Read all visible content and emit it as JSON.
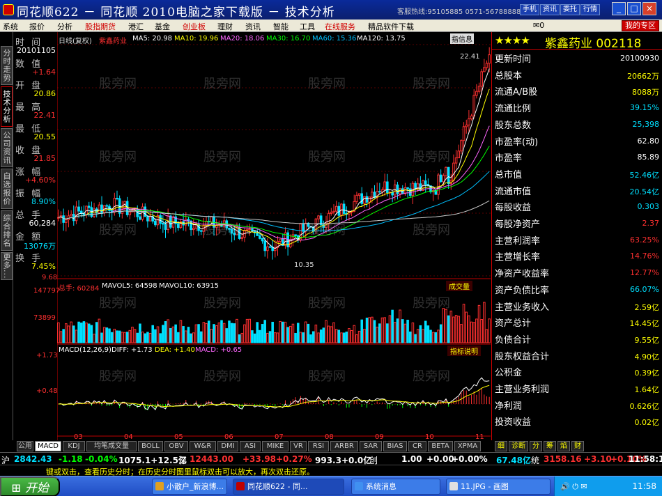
{
  "window": {
    "title": "同花顺622 － 同花顺 2010电脑之家下载版 － 技术分析",
    "hotline": "客服热线:95105885 0571-56788888",
    "buttons": [
      "手机",
      "资讯",
      "委托",
      "行情"
    ]
  },
  "menu": {
    "items": [
      {
        "label": "系统",
        "red": false
      },
      {
        "label": "报价",
        "red": false
      },
      {
        "label": "分析",
        "red": false
      },
      {
        "label": "股指期货",
        "red": true
      },
      {
        "label": "港汇",
        "red": false
      },
      {
        "label": "基金",
        "red": false
      },
      {
        "label": "创业板",
        "red": true
      },
      {
        "label": "理财",
        "red": false
      },
      {
        "label": "资讯",
        "red": false
      },
      {
        "label": "智能",
        "red": false
      },
      {
        "label": "工具",
        "red": false
      },
      {
        "label": "在线服务",
        "red": true
      },
      {
        "label": "精品软件下载",
        "red": false
      }
    ],
    "mail_count": "0",
    "zone_label": "我的专区"
  },
  "left_tabs": [
    {
      "label": "分时走势",
      "selected": false
    },
    {
      "label": "技术分析",
      "selected": true
    },
    {
      "label": "公司资讯",
      "selected": false
    },
    {
      "label": "自选报价",
      "selected": false
    },
    {
      "label": "综合排名",
      "selected": false
    },
    {
      "label": "更多...",
      "selected": false
    }
  ],
  "quote": [
    {
      "label": "时 间",
      "value": "20101105",
      "color": "#ffffff"
    },
    {
      "label": "数 值",
      "value": "+1.64",
      "color": "#ff3030"
    },
    {
      "label": "开 盘",
      "value": "20.86",
      "color": "#ffff00"
    },
    {
      "label": "最 高",
      "value": "22.41",
      "color": "#ff3030"
    },
    {
      "label": "最 低",
      "value": "20.55",
      "color": "#ffff00"
    },
    {
      "label": "收 盘",
      "value": "21.85",
      "color": "#ff3030"
    },
    {
      "label": "涨 幅",
      "value": "+4.60%",
      "color": "#ff3030"
    },
    {
      "label": "振 幅",
      "value": "8.90%",
      "color": "#00e0ff"
    },
    {
      "label": "总 手",
      "value": "60,284",
      "color": "#ffffff"
    },
    {
      "label": "金 额",
      "value": "13076万",
      "color": "#00e0ff"
    },
    {
      "label": "换 手",
      "value": "7.45%",
      "color": "#ffff00"
    }
  ],
  "chart": {
    "header": {
      "period": "日线(复权)",
      "name": "紫鑫药业",
      "ma5": "MA5: 20.98",
      "ma10": "MA10: 19.96",
      "ma20": "MA20: 18.06",
      "ma30": "MA30: 16.70",
      "ma60": "MA60: 15.36",
      "ma120": "MA120: 13.75"
    },
    "buttons": [
      "指",
      "信",
      "息"
    ],
    "high_label": "22.41",
    "low_label": "10.35",
    "ymin_label": "9.68",
    "volume": {
      "total": "总手: 60284",
      "mavol5": "MAVOL5: 64598",
      "mavol10": "MAVOL10: 63915",
      "tab": "成交量",
      "axis_top": "147797",
      "axis_mid": "73899"
    },
    "macd": {
      "header": "MACD(12,26,9)",
      "diff": "DIFF: +1.73",
      "dea": "DEA: +1.40",
      "macd": "MACD: +0.65",
      "tab": "指标说明",
      "axis_top": "+1.73",
      "axis_mid": "+0.48"
    },
    "watermark": "股旁网",
    "x_labels": [
      "03",
      "04",
      "05",
      "06",
      "07",
      "08",
      "09",
      "10",
      "11"
    ]
  },
  "chart_data": {
    "type": "candlestick",
    "symbol": "紫鑫药业",
    "x": [
      "2010-03",
      "2010-04",
      "2010-05",
      "2010-06",
      "2010-07",
      "2010-08",
      "2010-09",
      "2010-10",
      "2010-11"
    ],
    "close": [
      12.9,
      13.6,
      12.6,
      12.5,
      11.3,
      12.9,
      14.6,
      14.5,
      21.85
    ],
    "high": 22.41,
    "low": 10.35,
    "ylim": [
      9.68,
      22.41
    ],
    "ma": {
      "MA5": 20.98,
      "MA10": 19.96,
      "MA20": 18.06,
      "MA30": 16.7,
      "MA60": 15.36,
      "MA120": 13.75
    },
    "volume": {
      "total": 60284,
      "MAVOL5": 64598,
      "MAVOL10": 63915,
      "ylim": [
        0,
        147797
      ]
    },
    "macd": {
      "DIFF": 1.73,
      "DEA": 1.4,
      "MACD": 0.65
    }
  },
  "stock": {
    "stars": "★★★★",
    "name": "紫鑫药业 002118",
    "fields": [
      {
        "label": "更新时间",
        "value": "20100930",
        "color": "#ffffff"
      },
      {
        "label": "总股本",
        "value": "20662万",
        "color": "#ffff00"
      },
      {
        "label": "流通A/B股",
        "value": "8088万",
        "color": "#ffff00"
      },
      {
        "label": "流通比例",
        "value": "39.15%",
        "color": "#00e0ff"
      },
      {
        "label": "股东总数",
        "value": "25,398",
        "color": "#00e0ff"
      },
      {
        "label": "市盈率(动)",
        "value": "62.80",
        "color": "#ffffff"
      },
      {
        "label": "市盈率",
        "value": "85.89",
        "color": "#ffffff"
      },
      {
        "label": "总市值",
        "value": "52.46亿",
        "color": "#00e0ff"
      },
      {
        "label": "流通市值",
        "value": "20.54亿",
        "color": "#00e0ff"
      },
      {
        "label": "每股收益",
        "value": "0.303",
        "color": "#00e0ff"
      },
      {
        "label": "每股净资产",
        "value": "2.37",
        "color": "#ff3030"
      },
      {
        "label": "主营利润率",
        "value": "63.25%",
        "color": "#ff3030"
      },
      {
        "label": "主营增长率",
        "value": "14.76%",
        "color": "#ff3030"
      },
      {
        "label": "净资产收益率",
        "value": "12.77%",
        "color": "#ff3030"
      },
      {
        "label": "资产负债比率",
        "value": "66.07%",
        "color": "#00e0ff"
      },
      {
        "label": "主营业务收入",
        "value": "2.59亿",
        "color": "#ffff00"
      },
      {
        "label": "资产总计",
        "value": "14.45亿",
        "color": "#ffff00"
      },
      {
        "label": "负债合计",
        "value": "9.55亿",
        "color": "#ffff00"
      },
      {
        "label": "股东权益合计",
        "value": "4.90亿",
        "color": "#ffff00"
      },
      {
        "label": "公积金",
        "value": "0.39亿",
        "color": "#ffff00"
      },
      {
        "label": "主营业务利润",
        "value": "1.64亿",
        "color": "#ffff00"
      },
      {
        "label": "净利润",
        "value": "0.626亿",
        "color": "#ffff00"
      },
      {
        "label": "投资收益",
        "value": "0.02亿",
        "color": "#ffff00"
      }
    ]
  },
  "indicator_tabs": [
    {
      "label": "公用",
      "selected": false
    },
    {
      "label": "MACD",
      "selected": true
    },
    {
      "label": "KDJ",
      "selected": false
    },
    {
      "label": "均笔成交量",
      "selected": false
    },
    {
      "label": "BOLL",
      "selected": false
    },
    {
      "label": "OBV",
      "selected": false
    },
    {
      "label": "W&R",
      "selected": false
    },
    {
      "label": "DMI",
      "selected": false
    },
    {
      "label": "ASI",
      "selected": false
    },
    {
      "label": "MIKE",
      "selected": false
    },
    {
      "label": "VR",
      "selected": false
    },
    {
      "label": "RSI",
      "selected": false
    },
    {
      "label": "ARBR",
      "selected": false
    },
    {
      "label": "SAR",
      "selected": false
    },
    {
      "label": "BIAS",
      "selected": false
    },
    {
      "label": "CR",
      "selected": false
    },
    {
      "label": "BETA",
      "selected": false
    },
    {
      "label": "XPMA",
      "selected": false
    }
  ],
  "right_tabs": [
    "细",
    "诊断",
    "分",
    "筹",
    "焰",
    "财"
  ],
  "ticker": [
    {
      "text": "沪",
      "color": "#ffffff"
    },
    {
      "text": "2842.43",
      "color": "#00e0ff"
    },
    {
      "text": "-1.18",
      "color": "#00ff00"
    },
    {
      "text": "-0.04%",
      "color": "#00ff00"
    },
    {
      "text": "1075.1+12.5亿",
      "color": "#ffffff"
    },
    {
      "text": "深",
      "color": "#ffffff"
    },
    {
      "text": "12443.00",
      "color": "#ff3030"
    },
    {
      "text": "+33.98",
      "color": "#ff3030"
    },
    {
      "text": "+0.27%",
      "color": "#ff3030"
    },
    {
      "text": "993.3+0.0亿",
      "color": "#ffffff"
    },
    {
      "text": "创",
      "color": "#ffffff"
    },
    {
      "text": "1.00",
      "color": "#ffffff"
    },
    {
      "text": "+0.00",
      "color": "#ffffff"
    },
    {
      "text": "+0.00%",
      "color": "#ffffff"
    },
    {
      "text": "67.48亿",
      "color": "#00e0ff"
    },
    {
      "text": "统",
      "color": "#ffffff"
    },
    {
      "text": "3158.16",
      "color": "#ff3030"
    },
    {
      "text": "+3.10",
      "color": "#ff3030"
    },
    {
      "text": "+0.10%",
      "color": "#ff3030"
    },
    {
      "text": "11:58:13",
      "color": "#ffffff"
    }
  ],
  "tip": "键或双击，查看历史分时；在历史分时图里鼠标双击可以放大，再次双击还原。",
  "taskbar": {
    "start": "开始",
    "tasks": [
      {
        "label": "小散户_新浪博...",
        "active": false,
        "color": "#e0a020"
      },
      {
        "label": "同花顺622 - 同...",
        "active": true,
        "color": "#c00000"
      },
      {
        "label": "系统消息",
        "active": false,
        "color": "#4090f0"
      },
      {
        "label": "11.JPG - 画图",
        "active": false,
        "color": "#e0e0e0"
      }
    ],
    "clock": "11:58"
  }
}
